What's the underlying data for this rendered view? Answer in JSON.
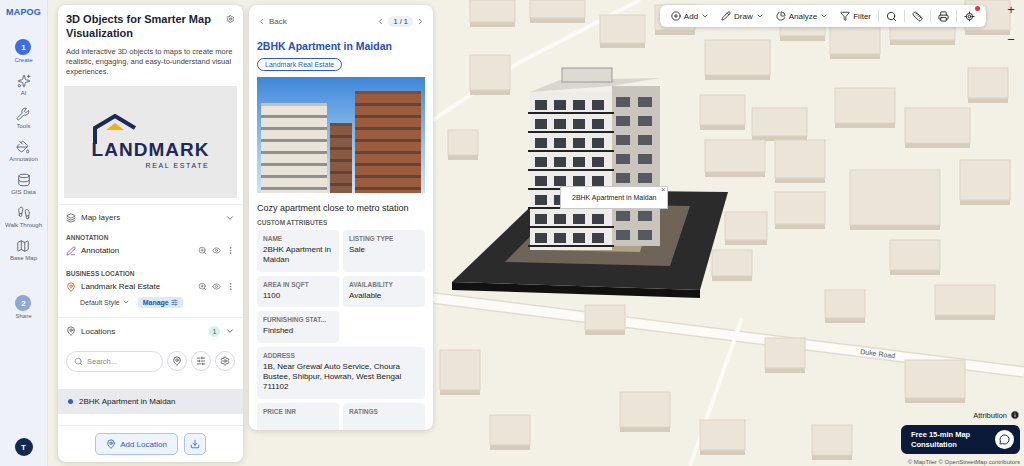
{
  "brand": {
    "name": "MAPOG"
  },
  "rail": {
    "items": [
      {
        "kind": "step",
        "number": "1",
        "label": "Create",
        "selected": true
      },
      {
        "kind": "tool",
        "label": "AI",
        "selected": false
      },
      {
        "kind": "tool",
        "label": "Tools",
        "selected": false
      },
      {
        "kind": "tool",
        "label": "Annotation",
        "selected": false
      },
      {
        "kind": "tool",
        "label": "GIS Data",
        "selected": false
      },
      {
        "kind": "tool",
        "label": "Walk Through",
        "selected": false
      },
      {
        "kind": "tool",
        "label": "Base Map",
        "selected": false
      },
      {
        "kind": "step",
        "number": "2",
        "label": "Share",
        "selected": false
      }
    ],
    "avatar": "T"
  },
  "panel": {
    "title": "3D Objects for Smarter Map Visualization",
    "description": "Add interactive 3D objects to maps to create more realistic, engaging, and easy-to-understand visual experiences.",
    "logo": {
      "name": "LANDMARK",
      "tagline": "REAL ESTATE"
    },
    "layers": {
      "title": "Map layers",
      "expanded": true,
      "groups": [
        {
          "heading": "ANNOTATION",
          "layers": [
            {
              "name": "Annotation",
              "visible": true
            }
          ]
        },
        {
          "heading": "BUSINESS LOCATION",
          "layers": [
            {
              "name": "Landmark Real Estate",
              "visible": true,
              "style": "Default Style",
              "action": "Manage"
            }
          ]
        }
      ]
    },
    "locations": {
      "title": "Locations",
      "count": "1",
      "expanded": true,
      "search_placeholder": "Search...",
      "items": [
        {
          "name": "2BHK Apartment in Maidan",
          "selected": true
        }
      ]
    },
    "add_button": "Add Location"
  },
  "detail": {
    "back": "Back",
    "pager": "1 / 1",
    "title": "2BHK Apartment in Maidan",
    "tag": "Landmark Real Estate",
    "description": "Cozy apartment close to metro station",
    "attributes_heading": "CUSTOM ATTRIBUTES",
    "attributes": [
      {
        "kind": "field",
        "label": "NAME",
        "value": "2BHK Apartment in Maidan"
      },
      {
        "kind": "field",
        "label": "LISTING TYPE",
        "value": "Sale"
      },
      {
        "kind": "field",
        "label": "AREA IN SQFT",
        "value": "1100"
      },
      {
        "kind": "field",
        "label": "AVAILABILITY",
        "value": "Available"
      },
      {
        "kind": "field",
        "label": "FURNISHING STAT...",
        "value": "Finished"
      },
      {
        "kind": "address",
        "label": "ADDRESS",
        "value": "1B, Near Grewal Auto Service, Choura Bustee, Shibpur, Howrah, West Bengal 711102"
      },
      {
        "kind": "field",
        "label": "PRICE INR"
      },
      {
        "kind": "field",
        "label": "RATINGS"
      }
    ]
  },
  "map": {
    "toolbar": [
      {
        "label": "Add",
        "dropdown": true
      },
      {
        "label": "Draw",
        "dropdown": true
      },
      {
        "label": "Analyze",
        "dropdown": true
      },
      {
        "label": "Filter",
        "dropdown": false
      }
    ],
    "alert": true,
    "zoom": {
      "in": "+",
      "out": "−"
    },
    "popup": {
      "title": "2BHK Apartment in Maidan",
      "close": "×"
    },
    "road_label": "Duke Road",
    "attribution": "Attribution",
    "consultation": "Free 15-min Map Consultation",
    "credits": "© MapTiler © OpenStreetMap contributors"
  }
}
